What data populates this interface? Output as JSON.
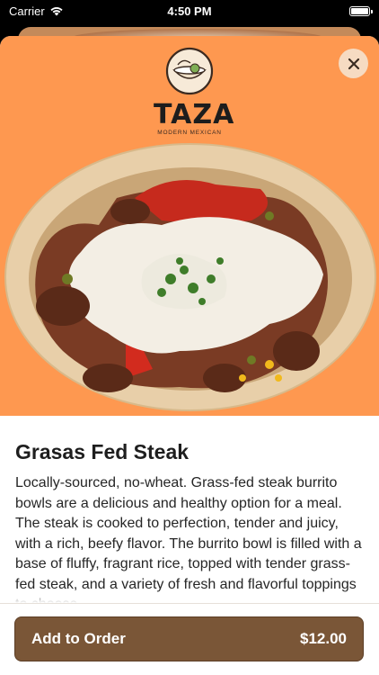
{
  "status_bar": {
    "carrier": "Carrier",
    "time": "4:50 PM"
  },
  "logo": {
    "word": "TAZA",
    "subtitle": "MODERN MEXICAN"
  },
  "item": {
    "title": "Grasas Fed Steak",
    "description": "Locally-sourced, no-wheat. Grass-fed steak burrito bowls are a delicious and healthy option for a meal. The steak is cooked to perfection, tender and juicy, with a rich, beefy flavor. The burrito bowl is filled with a base of fluffy, fragrant rice, topped with tender grass-fed steak, and a variety of fresh and flavorful toppings to choose"
  },
  "order": {
    "label": "Add to Order",
    "price": "$12.00"
  },
  "colors": {
    "hero_bg": "#fe9850",
    "button_bg": "#7a5637",
    "close_bg": "#f5dec8"
  }
}
